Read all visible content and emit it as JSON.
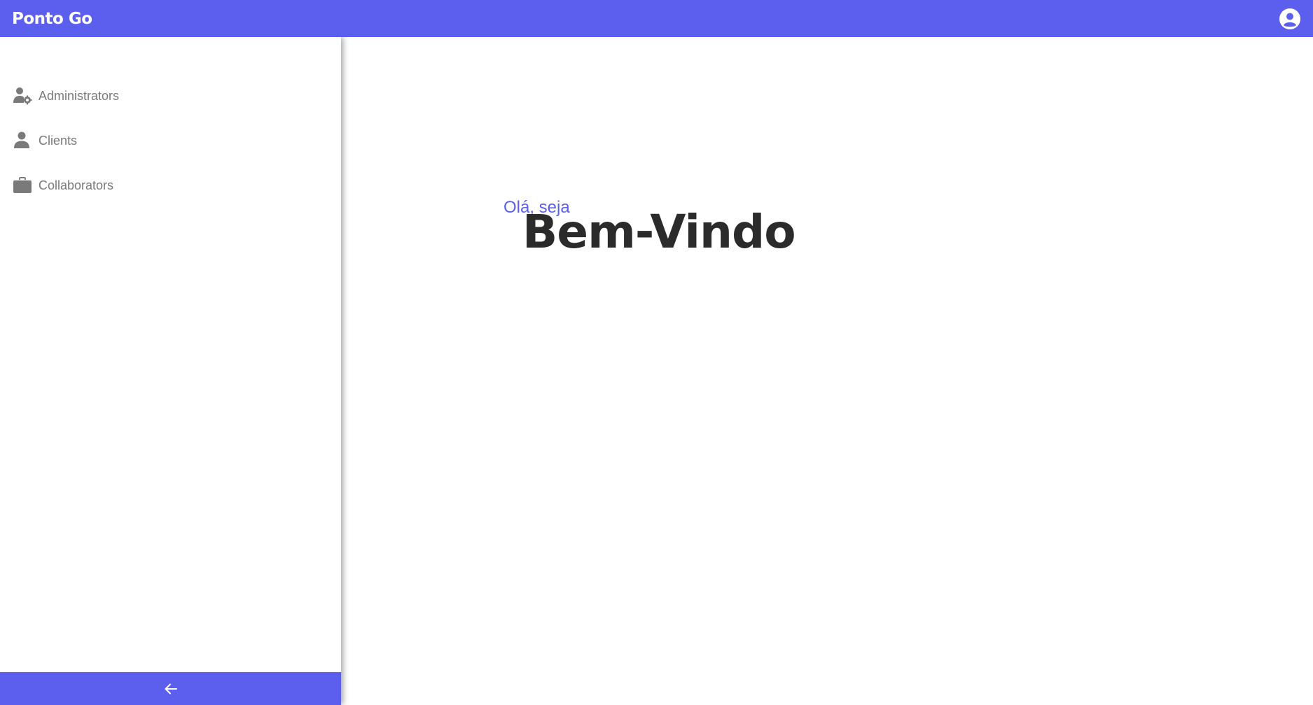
{
  "app": {
    "brand": "Ponto Go",
    "accent_color": "#5c5fee"
  },
  "header": {
    "account_icon": "account-circle-icon"
  },
  "sidebar": {
    "items": [
      {
        "label": "Administrators",
        "icon": "user-gear-icon"
      },
      {
        "label": "Clients",
        "icon": "user-icon"
      },
      {
        "label": "Collaborators",
        "icon": "briefcase-icon"
      }
    ],
    "collapse_icon": "arrow-left-icon"
  },
  "main": {
    "greeting": "Olá, seja",
    "headline": "Bem-Vindo"
  }
}
